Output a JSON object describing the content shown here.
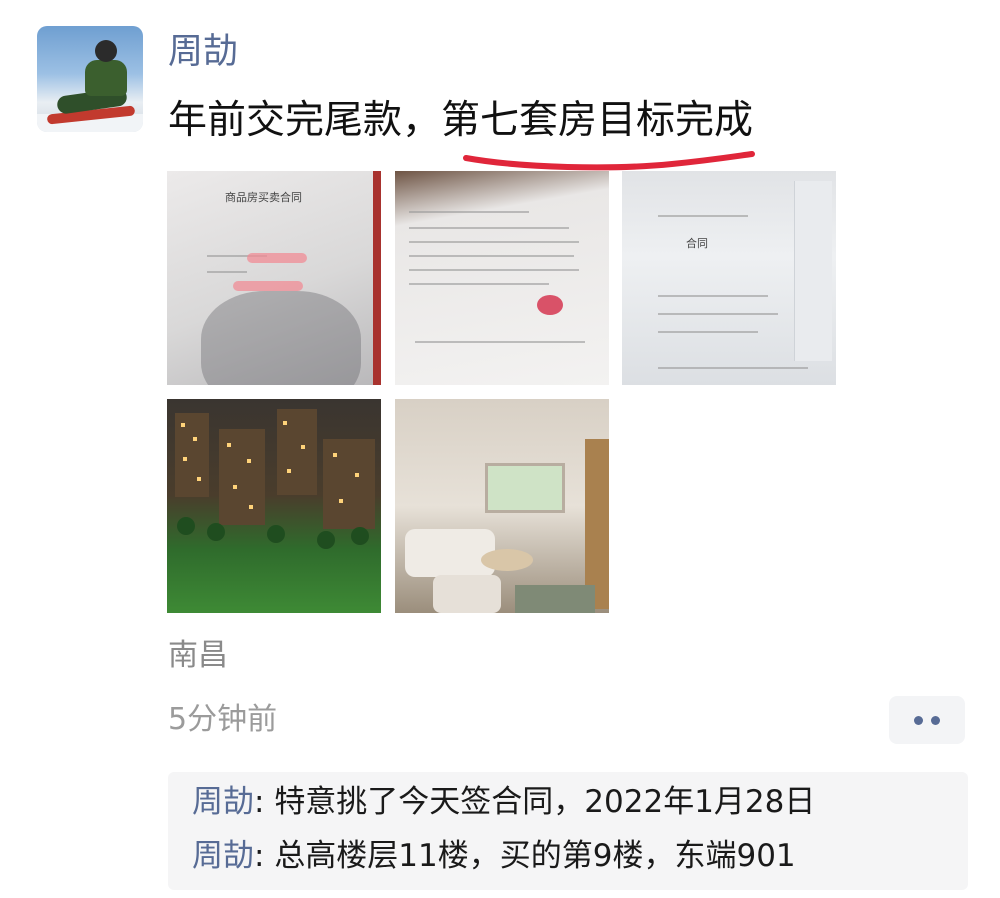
{
  "post": {
    "username": "周劼",
    "text": "年前交完尾款，第七套房目标完成",
    "location": "南昌",
    "time": "5分钟前"
  },
  "photos": [
    {
      "caption": "商品房买卖合同"
    },
    {
      "caption": ""
    },
    {
      "caption": "合同"
    },
    {
      "caption": ""
    },
    {
      "caption": ""
    }
  ],
  "comments": [
    {
      "name": "周劼",
      "sep": ": ",
      "text": "特意挑了今天签合同，2022年1月28日"
    },
    {
      "name": "周劼",
      "sep": ": ",
      "text": "总高楼层11楼，买的第9楼，东端901"
    }
  ],
  "colors": {
    "name_link": "#576b95",
    "underline_mark": "#e0263a",
    "comment_bg": "#f5f5f6"
  },
  "icons": {
    "more": "more-dots-icon"
  }
}
